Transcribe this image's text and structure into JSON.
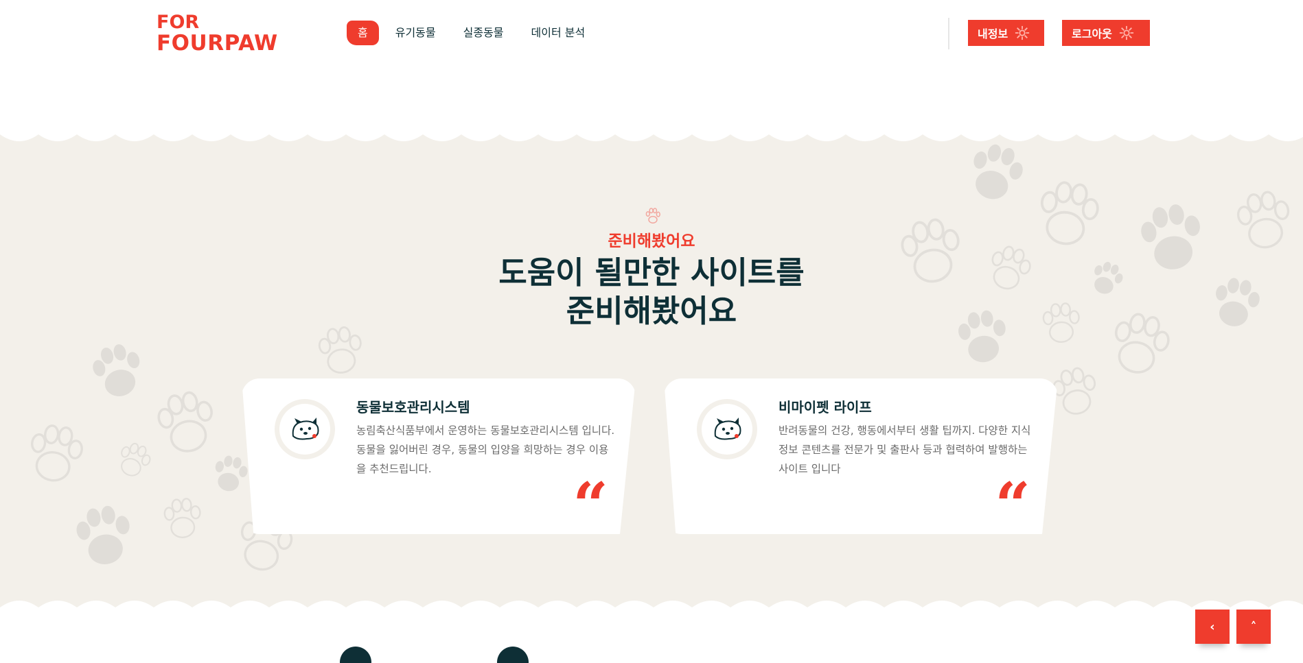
{
  "brand": {
    "logo_line1": "FOR",
    "logo_line2": "FOURPAW",
    "color": "#ef3c2d"
  },
  "nav": {
    "items": [
      {
        "label": "홈",
        "active": true
      },
      {
        "label": "유기동물",
        "active": false
      },
      {
        "label": "실종동물",
        "active": false
      },
      {
        "label": "데이터 분석",
        "active": false
      }
    ]
  },
  "header_buttons": {
    "myinfo_label": "내정보",
    "logout_label": "로그아웃"
  },
  "section": {
    "subtitle": "준비해봤어요",
    "title_line1": "도움이 될만한 사이트를",
    "title_line2": "준비해봤어요"
  },
  "cards": [
    {
      "title": "동물보호관리시스템",
      "desc": "농림축산식품부에서 운영하는 동물보호관리시스템 입니다. 동물을 잃어버린 경우, 동물의 입양을 희망하는 경우 이용을 추천드립니다.",
      "quote": "“"
    },
    {
      "title": "비마이펫 라이프",
      "desc": "반려동물의 건강, 행동에서부터 생활 팁까지. 다양한 지식정보 콘텐츠를 전문가 및 출판사 등과 협력하여 발행하는 사이트 입니다",
      "quote": "“"
    }
  ],
  "float_buttons": {
    "left_icon": "‹",
    "up_icon": "˄"
  },
  "icons": {
    "paw": "paw-icon",
    "gear": "gear-icon"
  },
  "colors": {
    "accent": "#ef3c2d",
    "dark": "#0e2f36",
    "beige": "#f3f0ea"
  }
}
